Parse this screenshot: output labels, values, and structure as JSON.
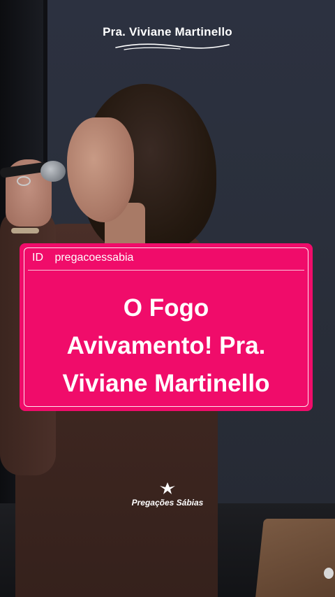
{
  "header": {
    "title": "Pra. Viviane Martinello"
  },
  "card": {
    "id_label": "ID",
    "id_value": "pregacoessabia",
    "title_line1": "O Fogo",
    "title_line2": "Avivamento! Pra.",
    "title_line3": "Viviane Martinello"
  },
  "logo": {
    "text": "Pregações Sábias"
  },
  "colors": {
    "card": "#f00c6a",
    "text": "#ffffff"
  },
  "icons": {
    "logo": "bird-icon"
  }
}
